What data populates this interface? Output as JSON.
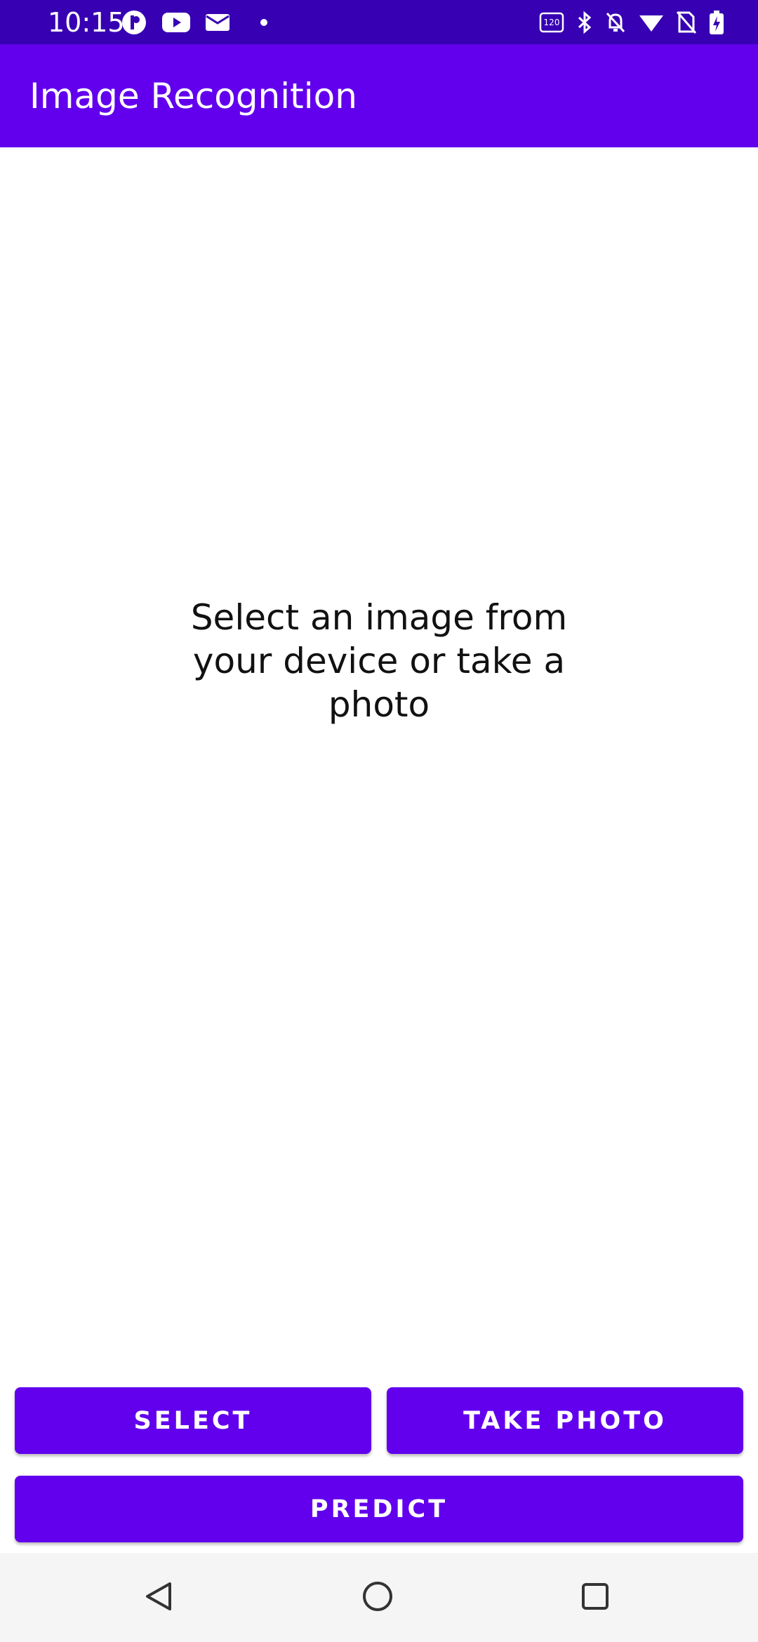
{
  "status_bar": {
    "time": "10:15",
    "left_icons": [
      "app-notification-icon",
      "youtube-icon",
      "mail-icon",
      "dot-icon"
    ],
    "right_icons": [
      "refresh-rate-120hz-icon",
      "bluetooth-icon",
      "bell-off-icon",
      "wifi-icon",
      "no-sim-icon",
      "battery-charging-icon"
    ]
  },
  "app_bar": {
    "title": "Image Recognition"
  },
  "main": {
    "placeholder_text": "Select an image from your device or take a photo"
  },
  "buttons": {
    "select_label": "SELECT",
    "take_photo_label": "TAKE PHOTO",
    "predict_label": "PREDICT"
  },
  "navigation": {
    "icons": [
      "back-icon",
      "home-icon",
      "recents-icon"
    ]
  },
  "colors": {
    "status_bar": "#3700b3",
    "primary": "#6200ee",
    "on_primary": "#ffffff",
    "background": "#ffffff",
    "nav_bar": "#f5f5f5"
  }
}
